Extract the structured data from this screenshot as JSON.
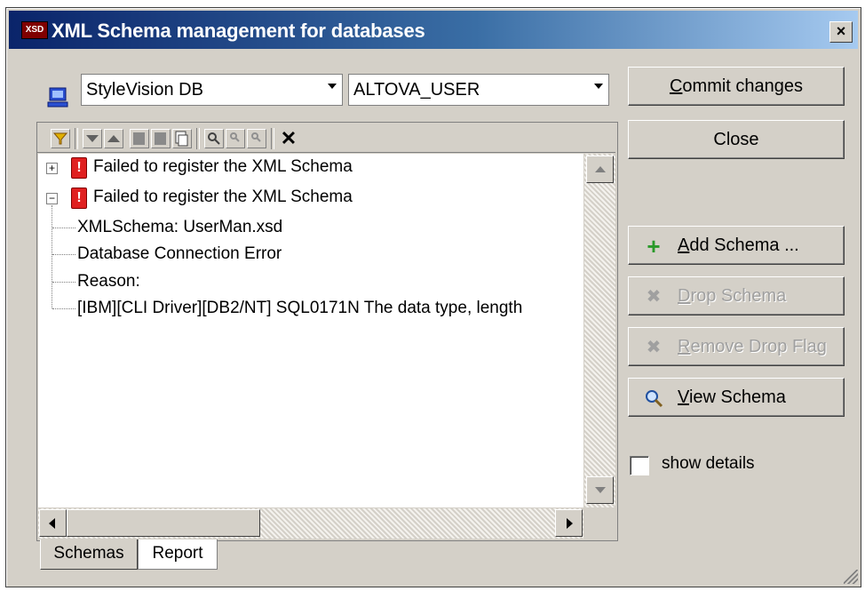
{
  "window": {
    "title": "XML Schema management for databases",
    "title_icon_text": "XSD",
    "close_symbol": "×"
  },
  "connection": {
    "database": "StyleVision DB",
    "user": "ALTOVA_USER",
    "icon": "database-connection-icon"
  },
  "toolbar": {
    "icons": [
      "filter-icon",
      "move-down-icon",
      "move-up-icon",
      "collapse-icon",
      "expand-icon",
      "copy-icon",
      "find-icon",
      "find-next-icon",
      "find-previous-icon",
      "clear-icon"
    ],
    "clear_symbol": "✕"
  },
  "tree": {
    "nodes": [
      {
        "text": "Failed to register the XML Schema",
        "expanded": false,
        "expander": "+",
        "icon_text": "!"
      },
      {
        "text": "Failed to register the XML Schema",
        "expanded": true,
        "expander": "−",
        "icon_text": "!",
        "children": [
          "XMLSchema: UserMan.xsd",
          "Database Connection Error",
          "Reason:",
          "[IBM][CLI Driver][DB2/NT] SQL0171N  The data type, length"
        ]
      }
    ]
  },
  "tabs": [
    {
      "label": "Schemas",
      "active": true
    },
    {
      "label": "Report",
      "active": false
    }
  ],
  "buttons": {
    "commit": {
      "label_pre": "",
      "label_u": "C",
      "label_post": "ommit changes"
    },
    "close": {
      "label": "Close"
    },
    "add": {
      "label_u": "A",
      "label_post": "dd Schema ...",
      "icon": "+",
      "enabled": true
    },
    "drop": {
      "label_u": "D",
      "label_post": "rop Schema",
      "icon": "✖",
      "enabled": false
    },
    "remove": {
      "label_u": "R",
      "label_post": "emove Drop Flag",
      "icon": "✖",
      "enabled": false
    },
    "view": {
      "label_u": "V",
      "label_post": "iew Schema",
      "icon": "🔍",
      "enabled": true
    }
  },
  "details": {
    "label": "show details",
    "checked": false
  },
  "colors": {
    "face": "#d4d0c8",
    "title_start": "#0a246a",
    "title_end": "#a6caf0",
    "error": "#e02020",
    "add_green": "#2a9a2a"
  }
}
